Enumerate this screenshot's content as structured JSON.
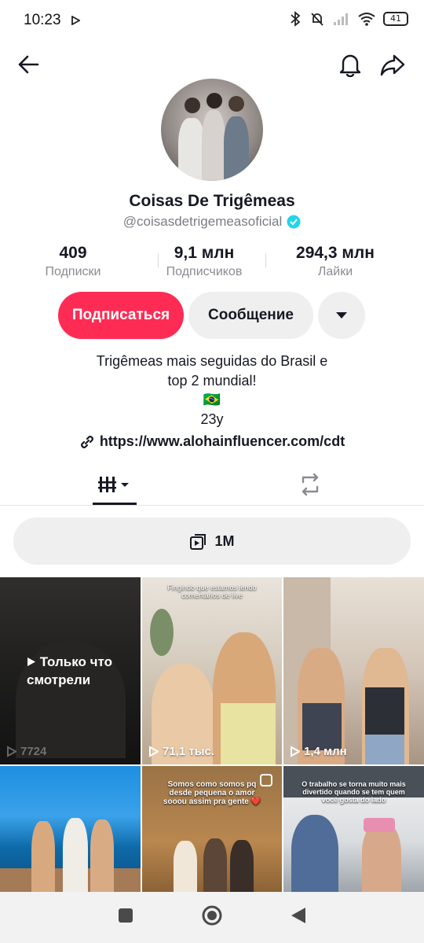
{
  "status_bar": {
    "time": "10:23",
    "battery": "41"
  },
  "profile": {
    "display_name": "Coisas De Trigêmeas",
    "username": "@coisasdetrigemeasoficial",
    "stats": [
      {
        "value": "409",
        "label": "Подписки"
      },
      {
        "value": "9,1 млн",
        "label": "Подписчиков"
      },
      {
        "value": "294,3 млн",
        "label": "Лайки"
      }
    ],
    "follow_label": "Подписаться",
    "message_label": "Сообщение",
    "bio_line1": "Trigêmeas mais seguidas do Brasil e",
    "bio_line2": "top 2 mundial!",
    "bio_flag": "🇧🇷",
    "bio_age": "23y",
    "link": "https://www.alohainfluencer.com/cdt"
  },
  "playlist": {
    "label": "1M"
  },
  "videos": [
    {
      "views": "7724",
      "overlay": "Только что смотрели",
      "caption": ""
    },
    {
      "views": "71,1 тыс.",
      "overlay": "",
      "caption": "Fingindo que estamos lendo comentários de live"
    },
    {
      "views": "1,4 млн",
      "overlay": "",
      "caption": ""
    },
    {
      "views": "",
      "overlay": "",
      "caption": ""
    },
    {
      "views": "",
      "overlay": "",
      "caption": "Somos como somos pq desde pequena o amor sooou assim pra gente ❤️"
    },
    {
      "views": "",
      "overlay": "",
      "caption": "O trabalho se torna muito mais divertido quando se tem quem você gosta do lado"
    }
  ],
  "colors": {
    "accent": "#fe2c55",
    "verified": "#20d5ec"
  }
}
